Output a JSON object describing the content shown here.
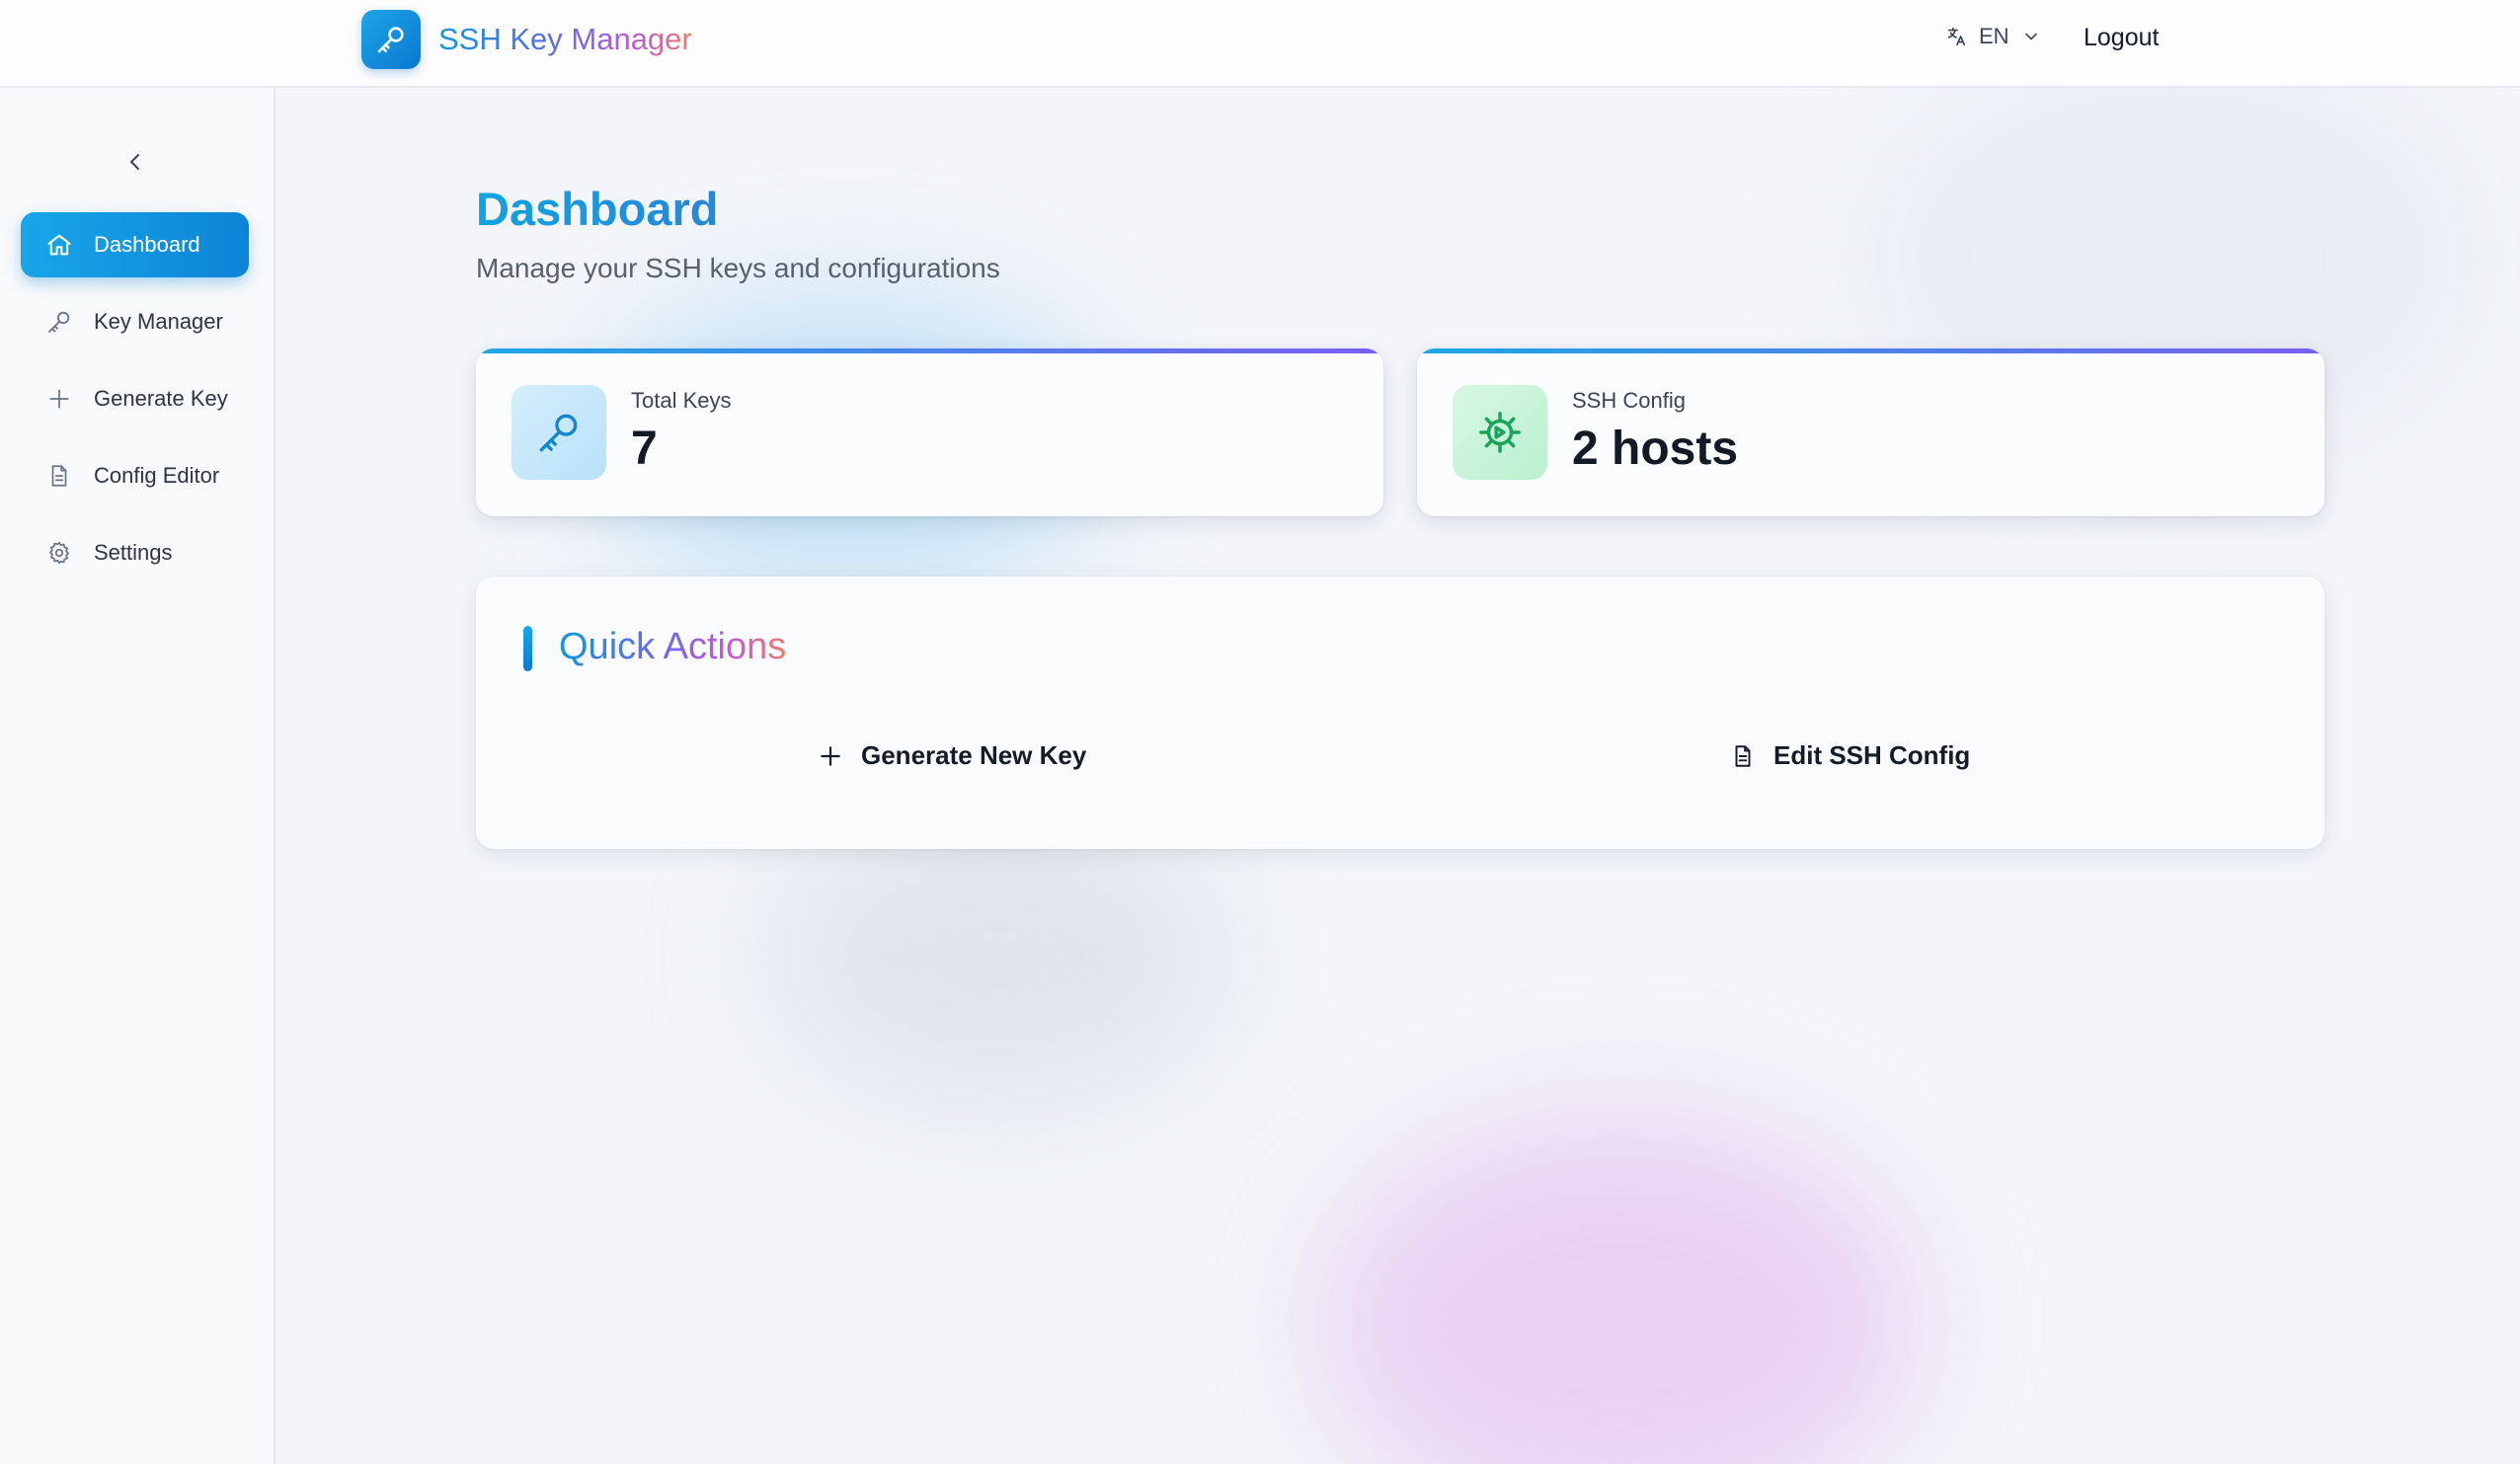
{
  "header": {
    "app_name": "SSH Key Manager",
    "language": "EN",
    "logout_label": "Logout"
  },
  "sidebar": {
    "items": [
      {
        "label": "Dashboard",
        "icon": "home-icon",
        "active": true
      },
      {
        "label": "Key Manager",
        "icon": "key-icon",
        "active": false
      },
      {
        "label": "Generate Key",
        "icon": "plus-icon",
        "active": false
      },
      {
        "label": "Config Editor",
        "icon": "document-icon",
        "active": false
      },
      {
        "label": "Settings",
        "icon": "gear-icon",
        "active": false
      }
    ]
  },
  "main": {
    "title": "Dashboard",
    "subtitle": "Manage your SSH keys and configurations",
    "stats": [
      {
        "label": "Total Keys",
        "value": "7",
        "icon": "key-icon"
      },
      {
        "label": "SSH Config",
        "value": "2 hosts",
        "icon": "cog-icon"
      }
    ],
    "quick_actions": {
      "title": "Quick Actions",
      "buttons": [
        {
          "label": "Generate New Key",
          "icon": "plus-icon"
        },
        {
          "label": "Edit SSH Config",
          "icon": "document-icon"
        }
      ]
    }
  },
  "colors": {
    "accent": "#1296d9",
    "accent_dark": "#0c84d6",
    "gradient_end": "#ea7e6c",
    "success": "#1aa35a"
  }
}
